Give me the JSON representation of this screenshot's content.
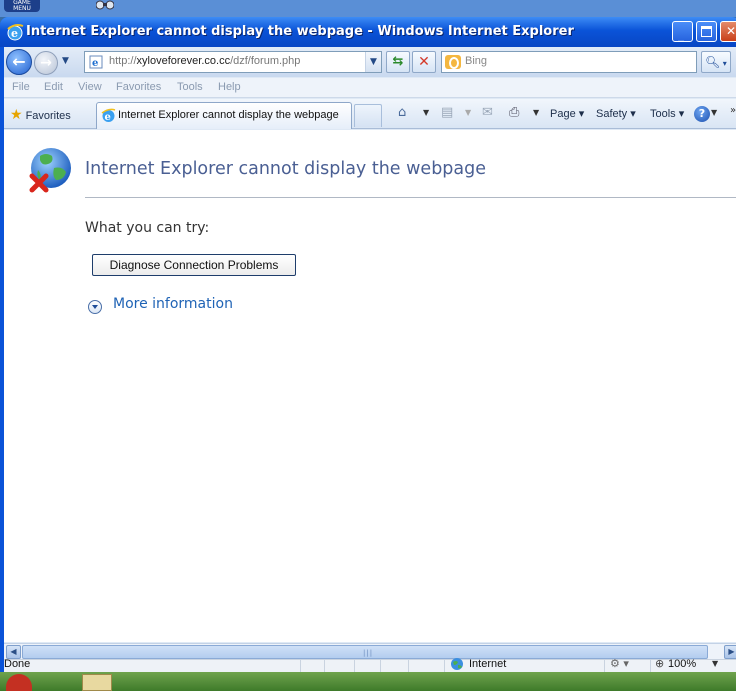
{
  "desktop": {
    "game_menu_label": "GAME MENU"
  },
  "window": {
    "title": "Internet Explorer cannot display the webpage - Windows Internet Explorer"
  },
  "address_bar": {
    "url_prefix": "http://",
    "url_host": "xyloveforever.co.cc",
    "url_path": "/dzf/forum.php"
  },
  "search": {
    "placeholder": "Bing"
  },
  "menu": {
    "items": [
      "File",
      "Edit",
      "View",
      "Favorites",
      "Tools",
      "Help"
    ]
  },
  "command_bar": {
    "favorites_label": "Favorites",
    "tab_title": "Internet Explorer cannot display the webpage",
    "page_label": "Page",
    "safety_label": "Safety",
    "tools_label": "Tools"
  },
  "error_page": {
    "title": "Internet Explorer cannot display the webpage",
    "try_heading": "What you can try:",
    "diagnose_button": "Diagnose Connection Problems",
    "more_info_link": "More information"
  },
  "status_bar": {
    "status": "Done",
    "zone": "Internet",
    "zoom": "100%"
  },
  "colors": {
    "title_bar": "#0a53d8",
    "error_title": "#4a5f93",
    "link": "#1f63b5"
  }
}
